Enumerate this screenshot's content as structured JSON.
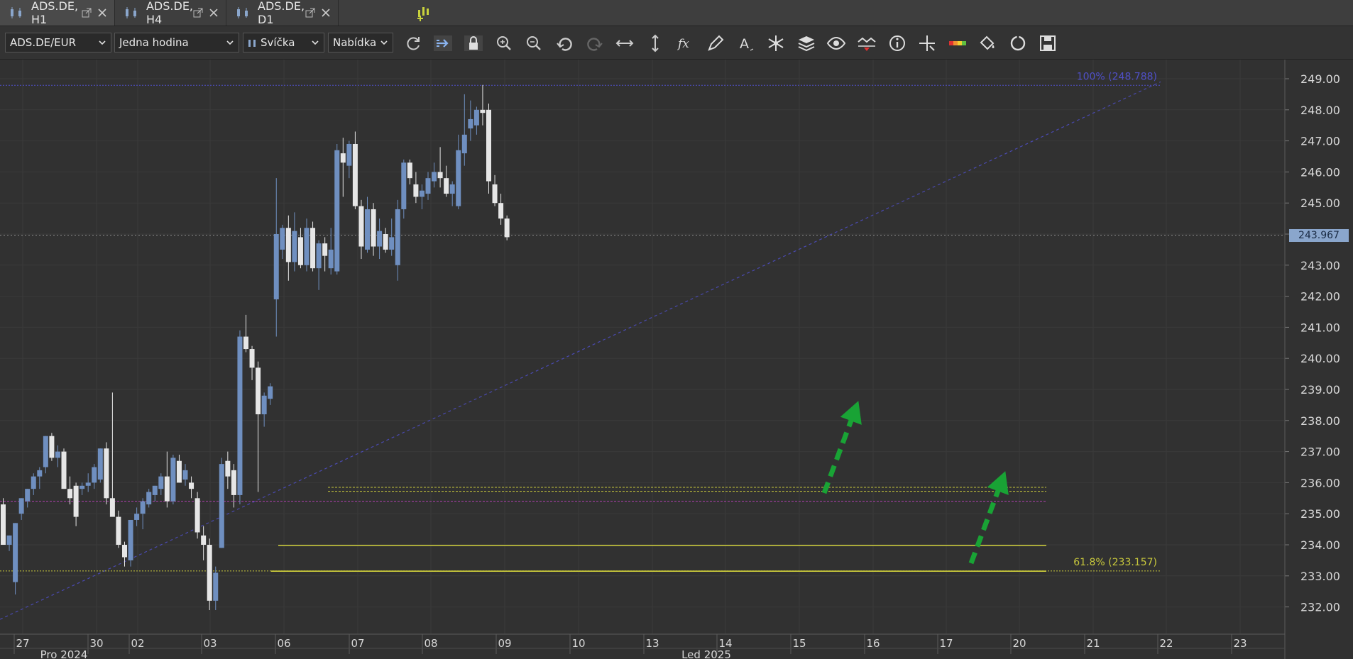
{
  "tabs": [
    {
      "label": "ADS.DE, H1",
      "active": true
    },
    {
      "label": "ADS.DE, H4",
      "active": false
    },
    {
      "label": "ADS.DE, D1",
      "active": false
    }
  ],
  "toolbar": {
    "instrument": "ADS.DE/EUR",
    "period": "Jedna hodina",
    "chart_type": "Svíčka",
    "offer_side": "Nabídka",
    "icons": [
      "refresh-icon",
      "shift-icon",
      "lock-icon",
      "zoom-in-icon",
      "zoom-out-icon",
      "undo-icon",
      "redo-icon",
      "horizontal-resize-icon",
      "vertical-resize-icon",
      "function-icon",
      "pencil-icon",
      "text-icon",
      "star-icon",
      "layers-icon",
      "eye-icon",
      "indicator-icon",
      "info-icon",
      "crosshair-icon",
      "color-scale-icon",
      "paint-icon",
      "reload-icon",
      "save-icon"
    ]
  },
  "chart_data": {
    "type": "candlestick",
    "y_ticks": [
      "249.00",
      "248.00",
      "247.00",
      "246.00",
      "245.00",
      "244.00",
      "243.00",
      "242.00",
      "241.00",
      "240.00",
      "239.00",
      "238.00",
      "237.00",
      "236.00",
      "235.00",
      "234.00",
      "233.00",
      "232.00"
    ],
    "y_range": [
      231.1,
      249.6
    ],
    "x_ticks": [
      "27",
      "30",
      "02",
      "03",
      "06",
      "07",
      "08",
      "09",
      "10",
      "13",
      "14",
      "15",
      "16",
      "17",
      "20",
      "21",
      "22",
      "23"
    ],
    "x_months": [
      "Pro 2024",
      "Led 2025"
    ],
    "current_price": "243.967",
    "fib_levels": [
      {
        "label": "100% (248.788)",
        "value": 248.788,
        "color": "#5050c8"
      },
      {
        "label": "61.8% (233.157)",
        "value": 233.157,
        "color": "#c8c83c"
      }
    ],
    "horizontal_lines": [
      {
        "value": 235.85,
        "color": "#c8c83c",
        "style": "dotted"
      },
      {
        "value": 235.72,
        "color": "#c8c83c",
        "style": "dotted"
      },
      {
        "value": 235.4,
        "color": "#b040b0",
        "style": "dotted"
      },
      {
        "value": 233.98,
        "color": "#d4d43c",
        "style": "solid"
      },
      {
        "value": 233.15,
        "color": "#d4d43c",
        "style": "solid"
      }
    ],
    "colors": {
      "bull": "#6f8fc0",
      "bear": "#e6e6e6",
      "background": "#313131",
      "grid": "#3a3a3a",
      "arrow": "#19a335"
    },
    "candles": [
      {
        "o": 235.3,
        "h": 235.5,
        "l": 234.0,
        "c": 234.0
      },
      {
        "o": 234.0,
        "h": 234.3,
        "l": 233.8,
        "c": 234.3
      },
      {
        "o": 232.8,
        "h": 234.7,
        "l": 232.4,
        "c": 234.7
      },
      {
        "o": 235.0,
        "h": 235.5,
        "l": 234.8,
        "c": 235.5
      },
      {
        "o": 235.4,
        "h": 235.8,
        "l": 235.2,
        "c": 235.8
      },
      {
        "o": 235.8,
        "h": 236.3,
        "l": 235.6,
        "c": 236.2
      },
      {
        "o": 236.2,
        "h": 236.5,
        "l": 235.8,
        "c": 236.4
      },
      {
        "o": 236.5,
        "h": 237.5,
        "l": 236.3,
        "c": 237.5
      },
      {
        "o": 237.5,
        "h": 237.6,
        "l": 236.7,
        "c": 236.8
      },
      {
        "o": 236.8,
        "h": 237.2,
        "l": 236.5,
        "c": 237.0
      },
      {
        "o": 237.0,
        "h": 237.1,
        "l": 235.8,
        "c": 235.8
      },
      {
        "o": 235.8,
        "h": 236.2,
        "l": 235.3,
        "c": 235.5
      },
      {
        "o": 235.9,
        "h": 236.0,
        "l": 234.6,
        "c": 234.9
      },
      {
        "o": 235.8,
        "h": 236.0,
        "l": 235.6,
        "c": 235.9
      },
      {
        "o": 235.9,
        "h": 236.3,
        "l": 235.7,
        "c": 236.0
      },
      {
        "o": 236.0,
        "h": 236.6,
        "l": 235.8,
        "c": 236.5
      },
      {
        "o": 236.1,
        "h": 237.1,
        "l": 236.0,
        "c": 237.1
      },
      {
        "o": 237.1,
        "h": 237.3,
        "l": 235.3,
        "c": 235.5
      },
      {
        "o": 235.5,
        "h": 238.9,
        "l": 235.0,
        "c": 234.9
      },
      {
        "o": 234.9,
        "h": 235.1,
        "l": 233.9,
        "c": 234.0
      },
      {
        "o": 234.0,
        "h": 234.1,
        "l": 233.3,
        "c": 233.6
      },
      {
        "o": 233.5,
        "h": 234.5,
        "l": 233.3,
        "c": 234.8
      },
      {
        "o": 234.8,
        "h": 235.2,
        "l": 234.6,
        "c": 235.0
      },
      {
        "o": 235.0,
        "h": 235.5,
        "l": 234.5,
        "c": 235.4
      },
      {
        "o": 235.3,
        "h": 235.8,
        "l": 235.2,
        "c": 235.7
      },
      {
        "o": 235.6,
        "h": 235.9,
        "l": 235.4,
        "c": 235.9
      },
      {
        "o": 235.8,
        "h": 236.3,
        "l": 235.6,
        "c": 236.2
      },
      {
        "o": 236.2,
        "h": 237.0,
        "l": 235.2,
        "c": 235.4
      },
      {
        "o": 235.4,
        "h": 236.9,
        "l": 235.3,
        "c": 236.8
      },
      {
        "o": 236.7,
        "h": 236.9,
        "l": 236.0,
        "c": 236.0
      },
      {
        "o": 236.1,
        "h": 236.6,
        "l": 235.9,
        "c": 236.4
      },
      {
        "o": 236.0,
        "h": 236.2,
        "l": 235.5,
        "c": 235.8
      },
      {
        "o": 235.5,
        "h": 235.7,
        "l": 234.2,
        "c": 234.4
      },
      {
        "o": 234.3,
        "h": 234.6,
        "l": 233.5,
        "c": 234.0
      },
      {
        "o": 234.0,
        "h": 234.2,
        "l": 231.9,
        "c": 232.2
      },
      {
        "o": 232.2,
        "h": 233.3,
        "l": 231.9,
        "c": 233.1
      },
      {
        "o": 233.9,
        "h": 236.8,
        "l": 233.9,
        "c": 236.6
      },
      {
        "o": 236.7,
        "h": 237.0,
        "l": 235.8,
        "c": 236.2
      },
      {
        "o": 236.4,
        "h": 236.6,
        "l": 235.2,
        "c": 235.6
      },
      {
        "o": 235.6,
        "h": 240.9,
        "l": 235.3,
        "c": 240.7
      },
      {
        "o": 240.7,
        "h": 241.4,
        "l": 240.2,
        "c": 240.3
      },
      {
        "o": 240.3,
        "h": 240.4,
        "l": 239.3,
        "c": 239.7
      },
      {
        "o": 239.7,
        "h": 239.9,
        "l": 235.7,
        "c": 238.2
      },
      {
        "o": 238.2,
        "h": 238.9,
        "l": 237.8,
        "c": 238.8
      },
      {
        "o": 238.7,
        "h": 239.2,
        "l": 238.5,
        "c": 239.1
      },
      {
        "o": 241.9,
        "h": 245.8,
        "l": 240.7,
        "c": 244.0
      },
      {
        "o": 243.5,
        "h": 244.3,
        "l": 243.2,
        "c": 244.2
      },
      {
        "o": 244.2,
        "h": 244.6,
        "l": 242.5,
        "c": 243.1
      },
      {
        "o": 243.1,
        "h": 244.7,
        "l": 242.8,
        "c": 244.1
      },
      {
        "o": 243.9,
        "h": 244.2,
        "l": 242.9,
        "c": 243.0
      },
      {
        "o": 243.0,
        "h": 244.5,
        "l": 242.8,
        "c": 244.2
      },
      {
        "o": 244.2,
        "h": 244.4,
        "l": 242.8,
        "c": 242.9
      },
      {
        "o": 242.9,
        "h": 243.8,
        "l": 242.2,
        "c": 243.7
      },
      {
        "o": 243.7,
        "h": 243.9,
        "l": 242.8,
        "c": 243.3
      },
      {
        "o": 242.9,
        "h": 244.2,
        "l": 242.7,
        "c": 243.5
      },
      {
        "o": 242.8,
        "h": 246.9,
        "l": 242.7,
        "c": 246.7
      },
      {
        "o": 246.6,
        "h": 247.1,
        "l": 245.2,
        "c": 246.3
      },
      {
        "o": 246.2,
        "h": 247.0,
        "l": 245.8,
        "c": 246.9
      },
      {
        "o": 246.9,
        "h": 247.3,
        "l": 244.8,
        "c": 244.9
      },
      {
        "o": 244.9,
        "h": 245.1,
        "l": 243.2,
        "c": 243.6
      },
      {
        "o": 243.5,
        "h": 245.2,
        "l": 243.4,
        "c": 244.8
      },
      {
        "o": 244.8,
        "h": 245.0,
        "l": 243.3,
        "c": 243.6
      },
      {
        "o": 243.6,
        "h": 244.5,
        "l": 243.2,
        "c": 244.1
      },
      {
        "o": 244.0,
        "h": 244.2,
        "l": 243.4,
        "c": 243.5
      },
      {
        "o": 243.5,
        "h": 244.5,
        "l": 243.3,
        "c": 243.9
      },
      {
        "o": 243.0,
        "h": 245.1,
        "l": 242.5,
        "c": 244.8
      },
      {
        "o": 244.8,
        "h": 246.4,
        "l": 244.5,
        "c": 246.3
      },
      {
        "o": 246.3,
        "h": 246.4,
        "l": 245.6,
        "c": 245.8
      },
      {
        "o": 245.6,
        "h": 246.0,
        "l": 245.0,
        "c": 245.2
      },
      {
        "o": 245.2,
        "h": 245.6,
        "l": 244.8,
        "c": 245.4
      },
      {
        "o": 245.3,
        "h": 246.0,
        "l": 245.1,
        "c": 245.8
      },
      {
        "o": 245.7,
        "h": 246.3,
        "l": 245.5,
        "c": 246.0
      },
      {
        "o": 246.0,
        "h": 246.8,
        "l": 245.5,
        "c": 245.8
      },
      {
        "o": 245.8,
        "h": 246.2,
        "l": 245.2,
        "c": 245.3
      },
      {
        "o": 245.3,
        "h": 245.7,
        "l": 244.9,
        "c": 245.6
      },
      {
        "o": 244.9,
        "h": 247.2,
        "l": 244.8,
        "c": 246.7
      },
      {
        "o": 246.6,
        "h": 248.5,
        "l": 246.2,
        "c": 247.2
      },
      {
        "o": 247.4,
        "h": 248.3,
        "l": 247.0,
        "c": 247.7
      },
      {
        "o": 247.5,
        "h": 248.1,
        "l": 247.2,
        "c": 248.0
      },
      {
        "o": 248.0,
        "h": 248.8,
        "l": 247.5,
        "c": 247.9
      },
      {
        "o": 248.0,
        "h": 248.2,
        "l": 245.3,
        "c": 245.7
      },
      {
        "o": 245.6,
        "h": 245.9,
        "l": 244.9,
        "c": 245.0
      },
      {
        "o": 245.0,
        "h": 245.3,
        "l": 244.3,
        "c": 244.5
      },
      {
        "o": 244.5,
        "h": 244.6,
        "l": 243.8,
        "c": 243.9
      }
    ]
  }
}
